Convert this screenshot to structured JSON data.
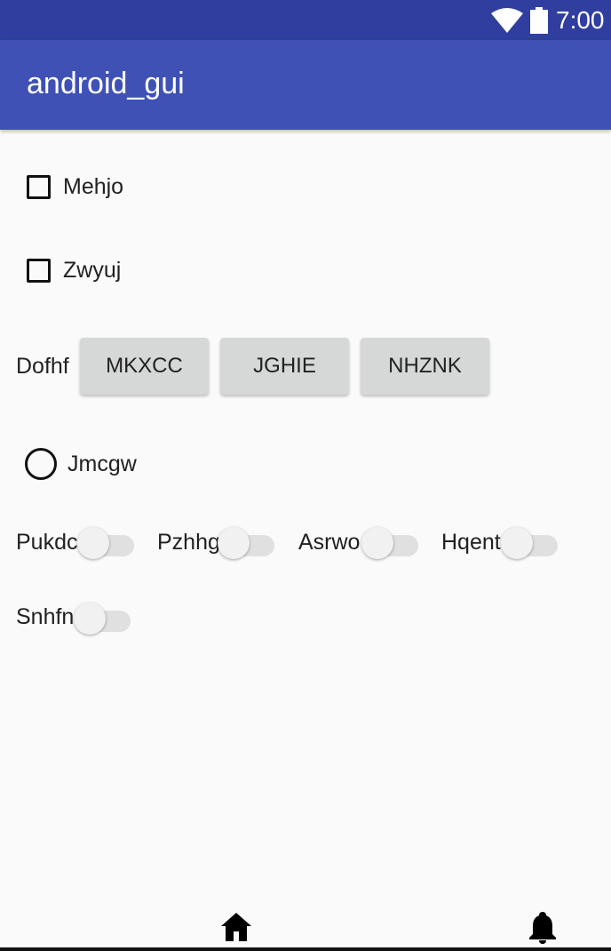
{
  "status_bar": {
    "time": "7:00",
    "icons": [
      "wifi-icon",
      "battery-icon"
    ],
    "background": "#303f9f"
  },
  "app_bar": {
    "title": "android_gui",
    "background": "#3f51b5"
  },
  "checkboxes": [
    {
      "label": "Mehjo",
      "checked": false
    },
    {
      "label": "Zwyuj",
      "checked": false
    }
  ],
  "button_group": {
    "label": "Dofhf",
    "buttons": [
      "MKXCC",
      "JGHIE",
      "NHZNK"
    ]
  },
  "radio": {
    "label": "Jmcgw",
    "selected": false
  },
  "switches": [
    {
      "label": "Pukdc",
      "on": false
    },
    {
      "label": "Pzhhg",
      "on": false
    },
    {
      "label": "Asrwo",
      "on": false
    },
    {
      "label": "Hqent",
      "on": false
    },
    {
      "label": "Snhfn",
      "on": false
    }
  ],
  "bottom_nav": {
    "icons": [
      "home-icon",
      "notification-bell-icon"
    ]
  }
}
